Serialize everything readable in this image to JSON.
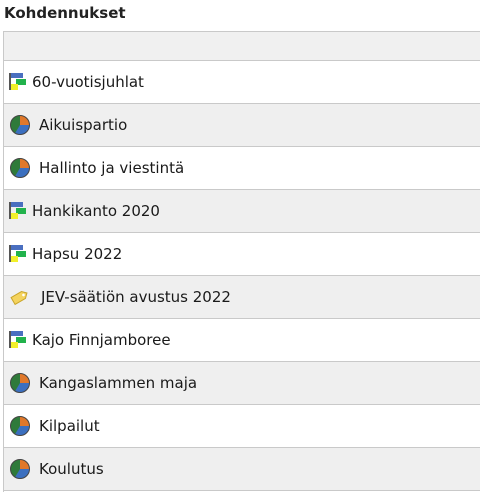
{
  "panel": {
    "title": "Kohdennukset"
  },
  "items": [
    {
      "label": "60-vuotisjuhlat",
      "icon": "project-gantt-icon"
    },
    {
      "label": "Aikuispartio",
      "icon": "pie-chart-icon"
    },
    {
      "label": "Hallinto ja viestintä",
      "icon": "pie-chart-icon"
    },
    {
      "label": "Hankikanto 2020",
      "icon": "project-gantt-icon"
    },
    {
      "label": "Hapsu 2022",
      "icon": "project-gantt-icon"
    },
    {
      "label": "JEV-säätiön avustus 2022",
      "icon": "tag-icon"
    },
    {
      "label": "Kajo Finnjamboree",
      "icon": "project-gantt-icon"
    },
    {
      "label": "Kangaslammen maja",
      "icon": "pie-chart-icon"
    },
    {
      "label": "Kilpailut",
      "icon": "pie-chart-icon"
    },
    {
      "label": "Koulutus",
      "icon": "pie-chart-icon"
    }
  ],
  "colors": {
    "row_alt": "#efefef",
    "border": "#c9c9c9"
  }
}
